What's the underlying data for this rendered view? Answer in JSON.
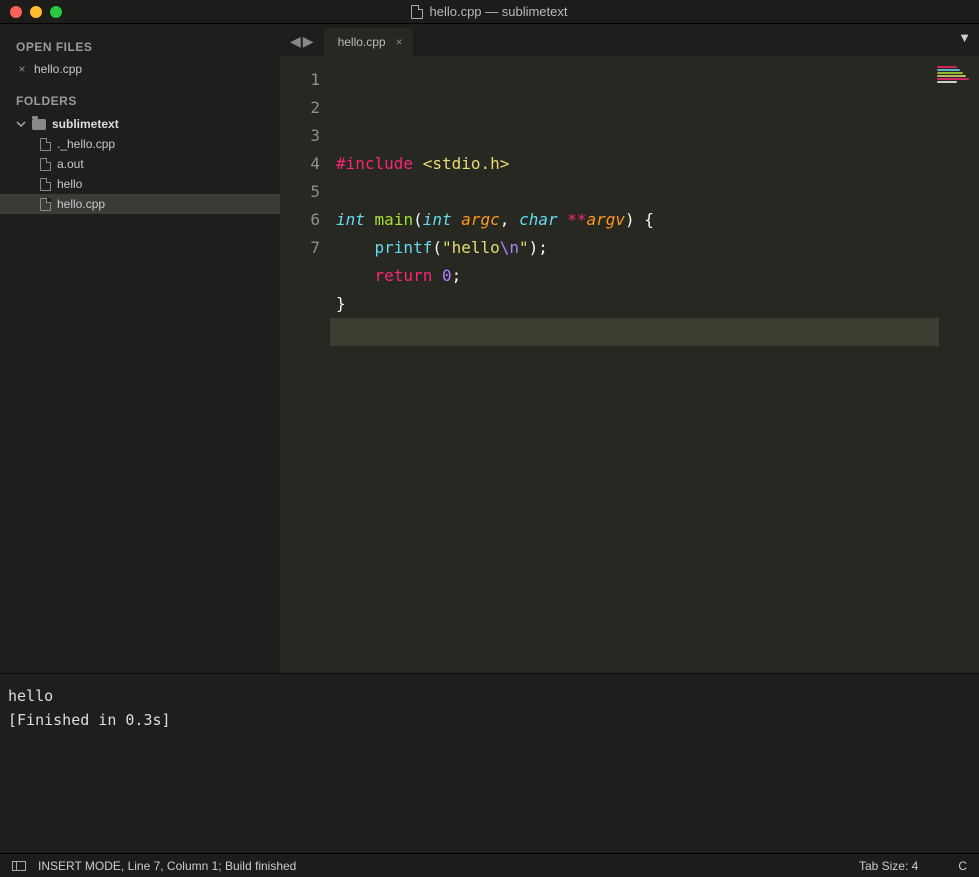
{
  "window": {
    "title": "hello.cpp — sublimetext"
  },
  "sidebar": {
    "open_files_label": "OPEN FILES",
    "open_files": [
      {
        "name": "hello.cpp"
      }
    ],
    "folders_label": "FOLDERS",
    "root_folder": "sublimetext",
    "files": [
      {
        "name": "._hello.cpp",
        "selected": false
      },
      {
        "name": "a.out",
        "selected": false
      },
      {
        "name": "hello",
        "selected": false
      },
      {
        "name": "hello.cpp",
        "selected": true
      }
    ]
  },
  "tabs": {
    "active": "hello.cpp"
  },
  "code": {
    "lines": [
      {
        "n": "1",
        "tokens": [
          {
            "t": "#include",
            "c": "kw-preproc"
          },
          {
            "t": " ",
            "c": ""
          },
          {
            "t": "<stdio.h>",
            "c": "str"
          }
        ]
      },
      {
        "n": "2",
        "tokens": []
      },
      {
        "n": "3",
        "tokens": [
          {
            "t": "int",
            "c": "kw-type"
          },
          {
            "t": " ",
            "c": ""
          },
          {
            "t": "main",
            "c": "fn-name"
          },
          {
            "t": "(",
            "c": "punct"
          },
          {
            "t": "int",
            "c": "kw-type"
          },
          {
            "t": " ",
            "c": ""
          },
          {
            "t": "argc",
            "c": "param"
          },
          {
            "t": ", ",
            "c": "punct"
          },
          {
            "t": "char",
            "c": "kw-type"
          },
          {
            "t": " ",
            "c": ""
          },
          {
            "t": "**",
            "c": "op"
          },
          {
            "t": "argv",
            "c": "param"
          },
          {
            "t": ")",
            "c": "punct"
          },
          {
            "t": " {",
            "c": "punct"
          }
        ]
      },
      {
        "n": "4",
        "tokens": [
          {
            "t": "    ",
            "c": ""
          },
          {
            "t": "printf",
            "c": "fn-call"
          },
          {
            "t": "(",
            "c": "punct"
          },
          {
            "t": "\"hello",
            "c": "str"
          },
          {
            "t": "\\n",
            "c": "str-esc"
          },
          {
            "t": "\"",
            "c": "str"
          },
          {
            "t": ");",
            "c": "punct"
          }
        ]
      },
      {
        "n": "5",
        "tokens": [
          {
            "t": "    ",
            "c": ""
          },
          {
            "t": "return",
            "c": "kw-flow"
          },
          {
            "t": " ",
            "c": ""
          },
          {
            "t": "0",
            "c": "num"
          },
          {
            "t": ";",
            "c": "punct"
          }
        ]
      },
      {
        "n": "6",
        "tokens": [
          {
            "t": "}",
            "c": "punct"
          }
        ]
      },
      {
        "n": "7",
        "tokens": [],
        "current": true
      }
    ]
  },
  "output": {
    "lines": [
      "hello",
      "[Finished in 0.3s]"
    ]
  },
  "statusbar": {
    "left": "INSERT MODE, Line 7, Column 1; Build finished",
    "tab_size": "Tab Size: 4",
    "syntax": "C"
  },
  "colors": {
    "minimap": [
      "#f92672",
      "#66d9ef",
      "#a6e22e",
      "#e6db74",
      "#f92672",
      "#f8f8f2"
    ]
  }
}
